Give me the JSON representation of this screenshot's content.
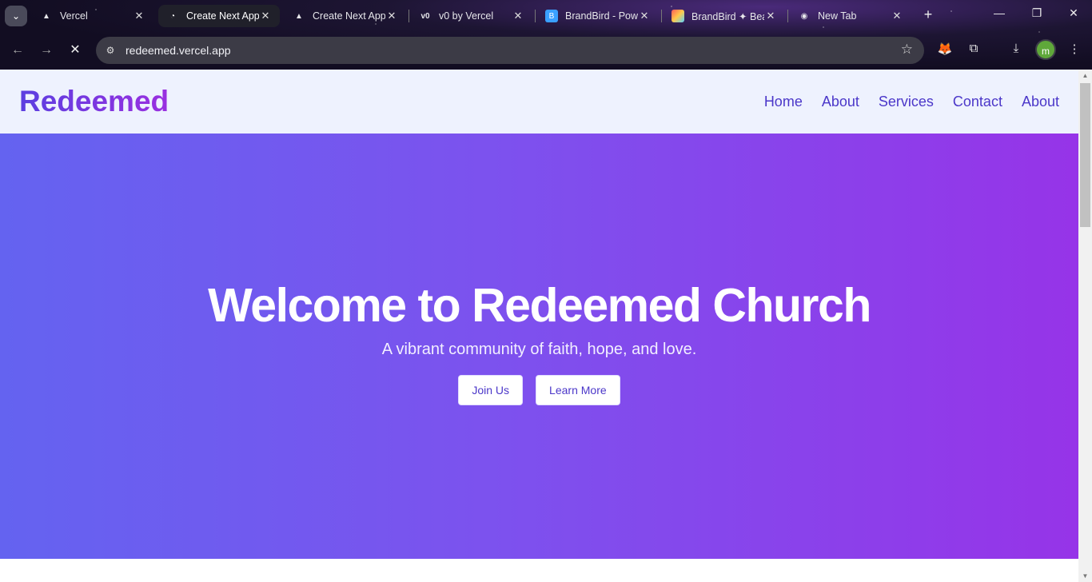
{
  "browser": {
    "tabs": [
      {
        "title": "Vercel",
        "favicon": "vercel-icon"
      },
      {
        "title": "Create Next App",
        "favicon": "nextjs-loading-icon",
        "active": true
      },
      {
        "title": "Create Next App",
        "favicon": "vercel-icon"
      },
      {
        "title": "v0 by Vercel",
        "favicon": "v0-icon"
      },
      {
        "title": "BrandBird - Pow",
        "favicon": "brandbird-icon"
      },
      {
        "title": "BrandBird ✦ Bea",
        "favicon": "brandbird-rainbow-icon"
      },
      {
        "title": "New Tab",
        "favicon": "chrome-icon"
      }
    ],
    "url": "redeemed.vercel.app",
    "profile_initial": "m"
  },
  "site": {
    "brand": "Redeemed",
    "nav": [
      "Home",
      "About",
      "Services",
      "Contact",
      "About"
    ],
    "hero": {
      "title": "Welcome to Redeemed Church",
      "subtitle": "A vibrant community of faith, hope, and love.",
      "primary_cta": "Join Us",
      "secondary_cta": "Learn More"
    }
  },
  "colors": {
    "brand_start": "#5b3fe0",
    "brand_end": "#9a2fe0",
    "nav_link": "#4b37c9",
    "hero_gradient_start": "#6463f0",
    "hero_gradient_end": "#9634e8",
    "header_bg": "#eef2fe"
  }
}
